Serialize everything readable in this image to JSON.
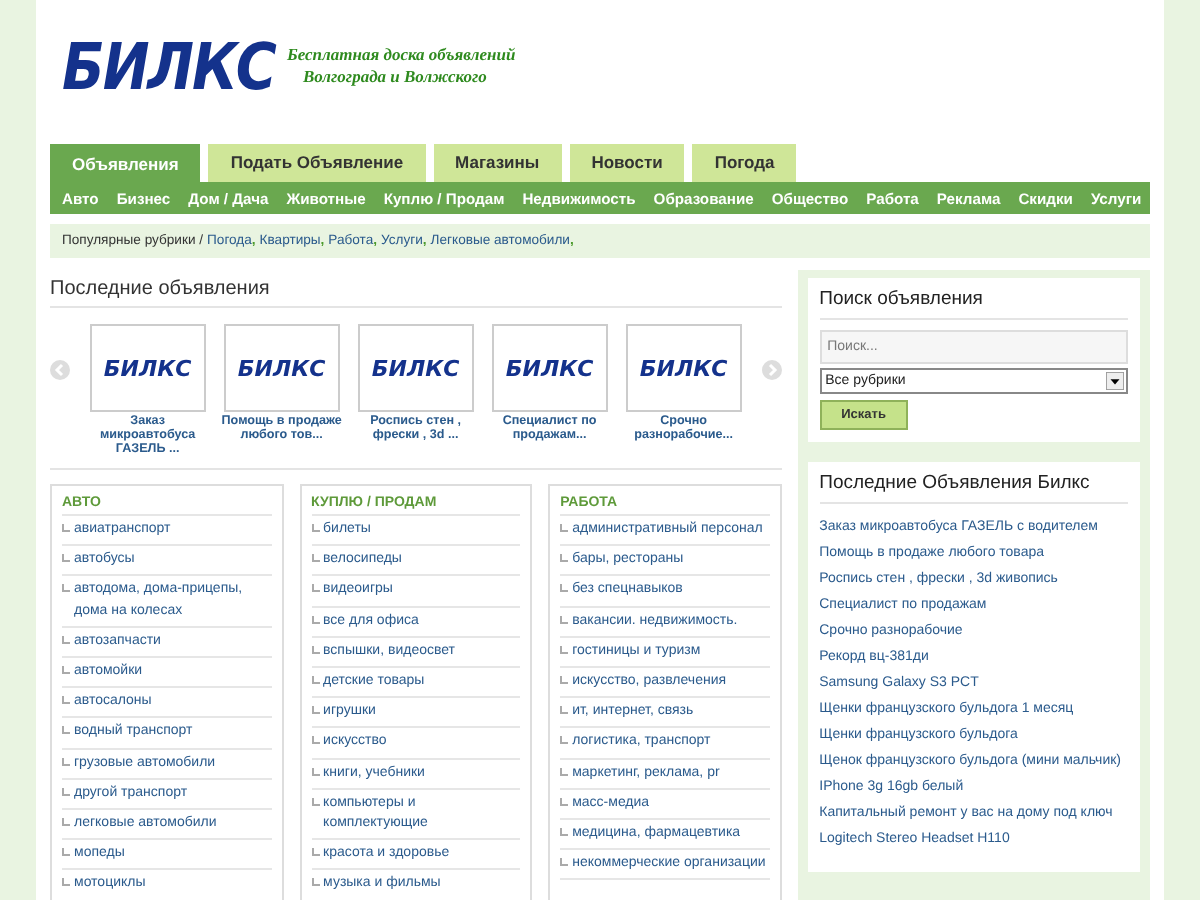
{
  "logo": {
    "name": "БИЛКС",
    "tagline": [
      "Бесплатная доска объявлений",
      "Волгограда и Волжского"
    ]
  },
  "tabs": [
    {
      "label": "Объявления",
      "selected": true
    },
    {
      "label": "Подать Объявление",
      "selected": false
    },
    {
      "label": "Магазины",
      "selected": false
    },
    {
      "label": "Новости",
      "selected": false
    },
    {
      "label": "Погода",
      "selected": false
    }
  ],
  "nav": [
    "Авто",
    "Бизнес",
    "Дом / Дача",
    "Животные",
    "Куплю / Продам",
    "Недвижимость",
    "Образование",
    "Общество",
    "Работа",
    "Реклама",
    "Скидки",
    "Услуги"
  ],
  "breadcrumb": {
    "label": "Популярные рубрики /",
    "separator": ",",
    "links": [
      "Погода",
      "Квартиры",
      "Работа",
      "Услуги",
      "Легковые автомобили"
    ]
  },
  "latest": {
    "title": "Последние объявления",
    "items": [
      {
        "logo": "БИЛКС",
        "caption": "Заказ микроавтобуса ГАЗЕЛЬ ..."
      },
      {
        "logo": "БИЛКС",
        "caption": "Помощь в продаже любого тов..."
      },
      {
        "logo": "БИЛКС",
        "caption": "Роспись стен , фрески , 3d ..."
      },
      {
        "logo": "БИЛКС",
        "caption": "Специалист по продажам..."
      },
      {
        "logo": "БИЛКС",
        "caption": "Срочно разнорабочие..."
      }
    ]
  },
  "categories": [
    {
      "title": "АВТО",
      "items": [
        "авиатранспорт",
        "автобусы",
        "автодома, дома-прицепы, дома на колесах",
        "автозапчасти",
        "автомойки",
        "автосалоны",
        "водный транспорт",
        "грузовые автомобили",
        "другой транспорт",
        "легковые автомобили",
        "мопеды",
        "мотоциклы"
      ]
    },
    {
      "title": "КУПЛЮ / ПРОДАМ",
      "items": [
        "билеты",
        "велосипеды",
        "видеоигры",
        "все для офиса",
        "вспышки, видеосвет",
        "детские товары",
        "игрушки",
        "искусство",
        "книги, учебники",
        "компьютеры и комплектующие",
        "красота и здоровье",
        "музыка и фильмы"
      ]
    },
    {
      "title": "РАБОТА",
      "items": [
        "административный персонал",
        "бары, рестораны",
        "без спецнавыков",
        "вакансии. недвижимость.",
        "гостиницы и туризм",
        "искусство, развлечения",
        "ит, интернет, связь",
        "логистика, транспорт",
        "маркетинг, реклама, pr",
        "масс-медиа",
        "медицина, фармацевтика",
        "некоммерческие организации"
      ]
    }
  ],
  "search": {
    "title": "Поиск объявления",
    "placeholder": "Поиск...",
    "select": "Все рубрики",
    "button": "Искать"
  },
  "recent": {
    "title": "Последние Объявления Билкс",
    "items": [
      "Заказ микроавтобуса ГАЗЕЛЬ с водителем",
      "Помощь в продаже любого товара",
      "Роспись стен , фрески , 3d живопись",
      "Специалист по продажам",
      "Срочно разнорабочие",
      "Рекорд вц-381ди",
      "Samsung Galaxy S3 PCT",
      "Щенки французского бульдога 1 месяц",
      "Щенки французского бульдога",
      "Щенок французского бульдога (мини мальчик)",
      "IPhone 3g 16gb белый",
      "Капитальный ремонт у вас на дому под ключ",
      "Logitech Stereo Headset H110"
    ]
  }
}
